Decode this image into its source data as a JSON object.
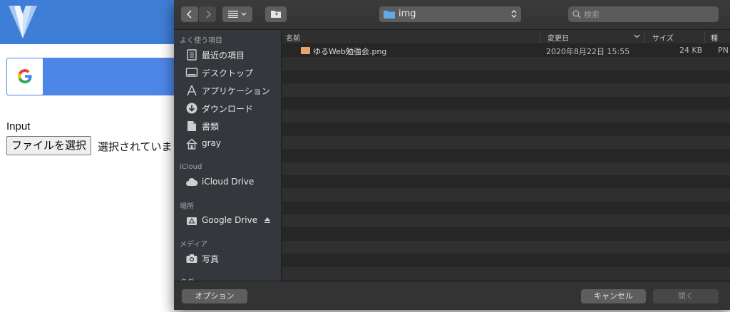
{
  "webpage": {
    "input_label": "Input",
    "file_button_label": "ファイルを選択",
    "file_status_text": "選択されていま"
  },
  "dialog": {
    "toolbar": {
      "back_icon": "chevron-left-icon",
      "forward_icon": "chevron-right-icon",
      "view_icon": "list-view-icon",
      "new_folder_icon": "new-folder-icon",
      "path_label": "img",
      "search_placeholder": "検索"
    },
    "sidebar": {
      "sections": [
        {
          "heading": "よく使う項目",
          "items": [
            {
              "label": "最近の項目",
              "icon": "recents-icon"
            },
            {
              "label": "デスクトップ",
              "icon": "desktop-icon"
            },
            {
              "label": "アプリケーション",
              "icon": "applications-icon"
            },
            {
              "label": "ダウンロード",
              "icon": "downloads-icon"
            },
            {
              "label": "書類",
              "icon": "documents-icon"
            },
            {
              "label": "gray",
              "icon": "home-icon"
            }
          ]
        },
        {
          "heading": "iCloud",
          "items": [
            {
              "label": "iCloud Drive",
              "icon": "cloud-icon"
            }
          ]
        },
        {
          "heading": "場所",
          "items": [
            {
              "label": "Google Drive",
              "icon": "drive-icon"
            }
          ]
        },
        {
          "heading": "メディア",
          "items": [
            {
              "label": "写真",
              "icon": "camera-icon"
            }
          ]
        },
        {
          "heading": "タグ",
          "items": []
        }
      ]
    },
    "columns": {
      "name": "名前",
      "modified": "変更日",
      "size": "サイズ",
      "kind": "種"
    },
    "files": [
      {
        "name": "ゆるWeb勉強会.png",
        "modified": "2020年8月22日 15:55",
        "size": "24 KB",
        "kind": "PN"
      }
    ],
    "buttons": {
      "options": "オプション",
      "cancel": "キャンセル",
      "open": "開く"
    },
    "colors": {
      "background": "#2a2a2a",
      "sidebar": "#34373b",
      "row_odd": "#2f2f2f",
      "row_even": "#262626",
      "header_blue": "#3f7ed6",
      "file_icon": "#e7a36a"
    }
  }
}
